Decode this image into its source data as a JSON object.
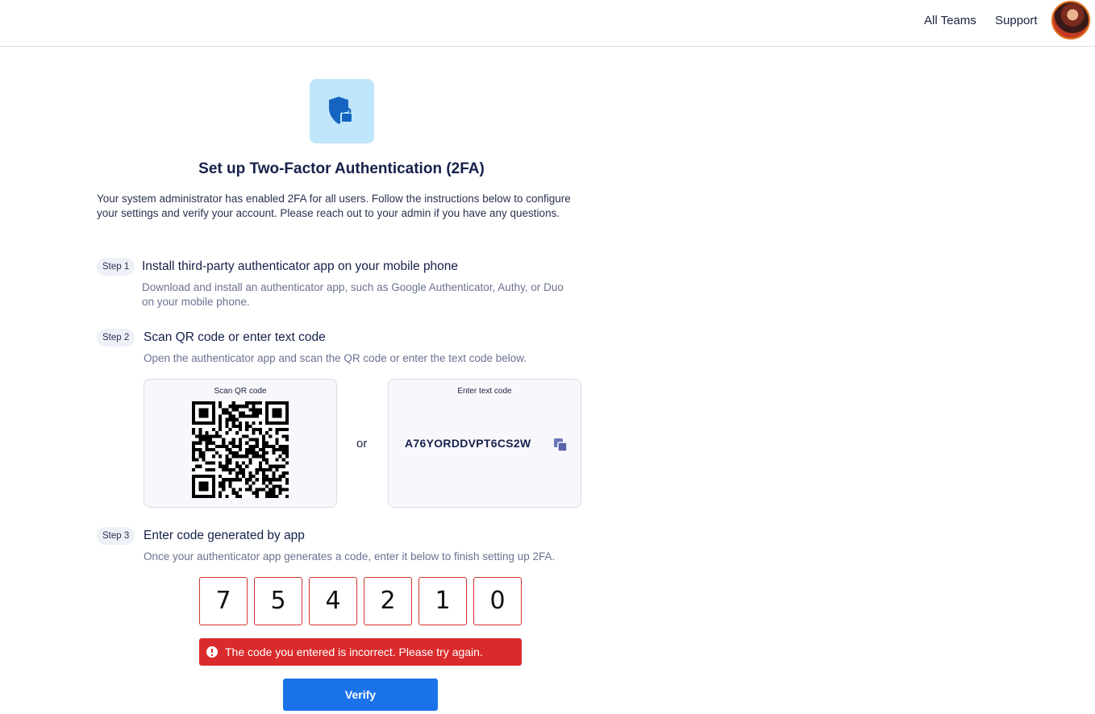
{
  "nav": {
    "all_teams": "All Teams",
    "support": "Support",
    "avatar_icon": "user-avatar"
  },
  "header": {
    "icon": "shield-lock-icon",
    "title": "Set up Two-Factor Authentication (2FA)",
    "intro": "Your system administrator has enabled 2FA for all users. Follow the instructions below to configure your settings and verify your account. Please reach out to your admin if you have any questions."
  },
  "steps": [
    {
      "badge": "Step 1",
      "title": "Install third-party authenticator app on your mobile phone",
      "description": "Download and install an authenticator app, such as Google Authenticator, Authy, or Duo on your mobile phone."
    },
    {
      "badge": "Step 2",
      "title": "Scan QR code or enter text code",
      "description": "Open the authenticator app and scan the QR code or enter the text code below."
    },
    {
      "badge": "Step 3",
      "title": "Enter code generated by app",
      "description": "Once your authenticator app generates a code, enter it below to finish setting up 2FA."
    }
  ],
  "qr_card": {
    "label": "Scan QR code",
    "icon": "qr-code"
  },
  "or_label": "or",
  "text_code_card": {
    "label": "Enter text code",
    "code": "A76YORDDVPT6CS2W",
    "copy_icon": "copy-icon"
  },
  "code_digits": [
    "7",
    "5",
    "4",
    "2",
    "1",
    "0"
  ],
  "error": {
    "icon": "alert-circle-icon",
    "message": "The code you entered is incorrect. Please try again.",
    "color": "#d92b2b"
  },
  "verify_button": {
    "label": "Verify",
    "color": "#1a73e8"
  }
}
